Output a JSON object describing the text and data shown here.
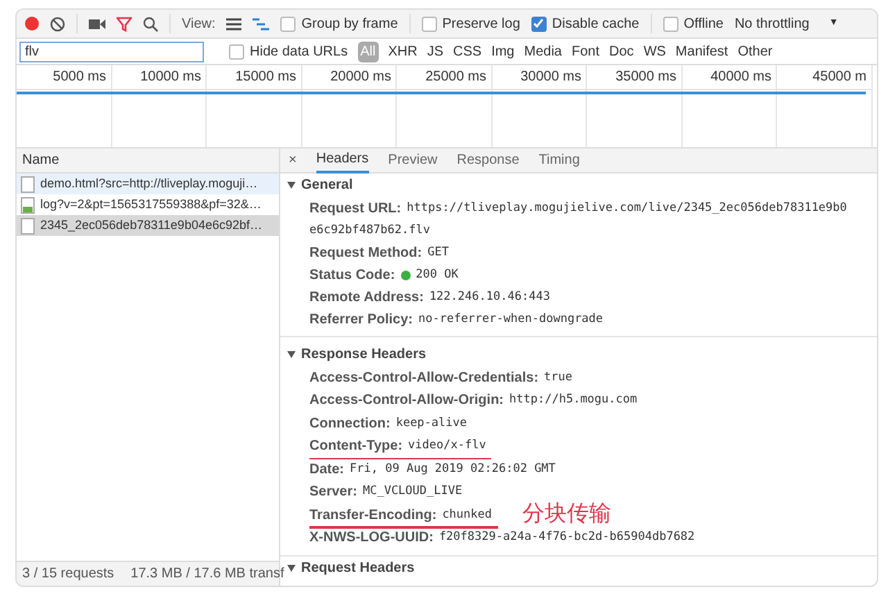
{
  "toolbar": {
    "view_label": "View:",
    "checkboxes": [
      {
        "label": "Group by frame",
        "checked": false
      },
      {
        "label": "Preserve log",
        "checked": false
      },
      {
        "label": "Disable cache",
        "checked": true
      },
      {
        "label": "Offline",
        "checked": false
      }
    ],
    "throttling": {
      "value": "No throttling",
      "caret": "▼"
    }
  },
  "filter_bar": {
    "value": "flv",
    "hide_data_urls": {
      "label": "Hide data URLs",
      "checked": false
    },
    "types": [
      {
        "label": "All",
        "selected": true
      },
      {
        "label": "XHR",
        "selected": false
      },
      {
        "label": "JS",
        "selected": false
      },
      {
        "label": "CSS",
        "selected": false
      },
      {
        "label": "Img",
        "selected": false
      },
      {
        "label": "Media",
        "selected": false
      },
      {
        "label": "Font",
        "selected": false
      },
      {
        "label": "Doc",
        "selected": false
      },
      {
        "label": "WS",
        "selected": false
      },
      {
        "label": "Manifest",
        "selected": false
      },
      {
        "label": "Other",
        "selected": false
      }
    ]
  },
  "timeline": {
    "ticks": [
      "5000 ms",
      "10000 ms",
      "15000 ms",
      "20000 ms",
      "25000 ms",
      "30000 ms",
      "35000 ms",
      "40000 ms",
      "45000 m"
    ]
  },
  "requests": {
    "column": "Name",
    "rows": [
      {
        "name": "demo.html?src=http://tliveplay.moguji…",
        "kind": "document",
        "selected": false,
        "hovered": true
      },
      {
        "name": "log?v=2&pt=1565317559388&pf=32&…",
        "kind": "image",
        "selected": false,
        "hovered": false
      },
      {
        "name": "2345_2ec056deb78311e9b04e6c92bf…",
        "kind": "document",
        "selected": true,
        "hovered": false
      }
    ]
  },
  "status_bar": {
    "requests": "3 / 15 requests",
    "transferred": "17.3 MB / 17.6 MB transf"
  },
  "details": {
    "close": "×",
    "tabs": [
      {
        "label": "Headers",
        "selected": true
      },
      {
        "label": "Preview",
        "selected": false
      },
      {
        "label": "Response",
        "selected": false
      },
      {
        "label": "Timing",
        "selected": false
      }
    ],
    "general": {
      "title": "General",
      "items": [
        {
          "label": "Request URL:",
          "value": "https://tliveplay.mogujielive.com/live/2345_2ec056deb78311e9b0",
          "continuation": "e6c92bf487b62.flv"
        },
        {
          "label": "Request Method:",
          "value": "GET"
        },
        {
          "label": "Status Code:",
          "value": "200 OK",
          "color": "#3cb043"
        },
        {
          "label": "Remote Address:",
          "value": "122.246.10.46:443"
        },
        {
          "label": "Referrer Policy:",
          "value": "no-referrer-when-downgrade"
        }
      ]
    },
    "response_headers": {
      "title": "Response Headers",
      "items": [
        {
          "label": "Access-Control-Allow-Credentials:",
          "value": "true",
          "underlined": false
        },
        {
          "label": "Access-Control-Allow-Origin:",
          "value": "http://h5.mogu.com",
          "underlined": false
        },
        {
          "label": "Connection:",
          "value": "keep-alive",
          "underlined": false
        },
        {
          "label": "Content-Type:",
          "value": "video/x-flv",
          "underlined": true
        },
        {
          "label": "Date:",
          "value": "Fri, 09 Aug 2019 02:26:02 GMT",
          "underlined": false
        },
        {
          "label": "Server:",
          "value": "MC_VCLOUD_LIVE",
          "underlined": false
        },
        {
          "label": "Transfer-Encoding:",
          "value": "chunked",
          "underlined": true,
          "annotation": "分块传输"
        },
        {
          "label": "X-NWS-LOG-UUID:",
          "value": "f20f8329-a24a-4f76-bc2d-b65904db7682",
          "underlined": false
        }
      ]
    },
    "request_headers": {
      "title": "Request Headers"
    }
  }
}
